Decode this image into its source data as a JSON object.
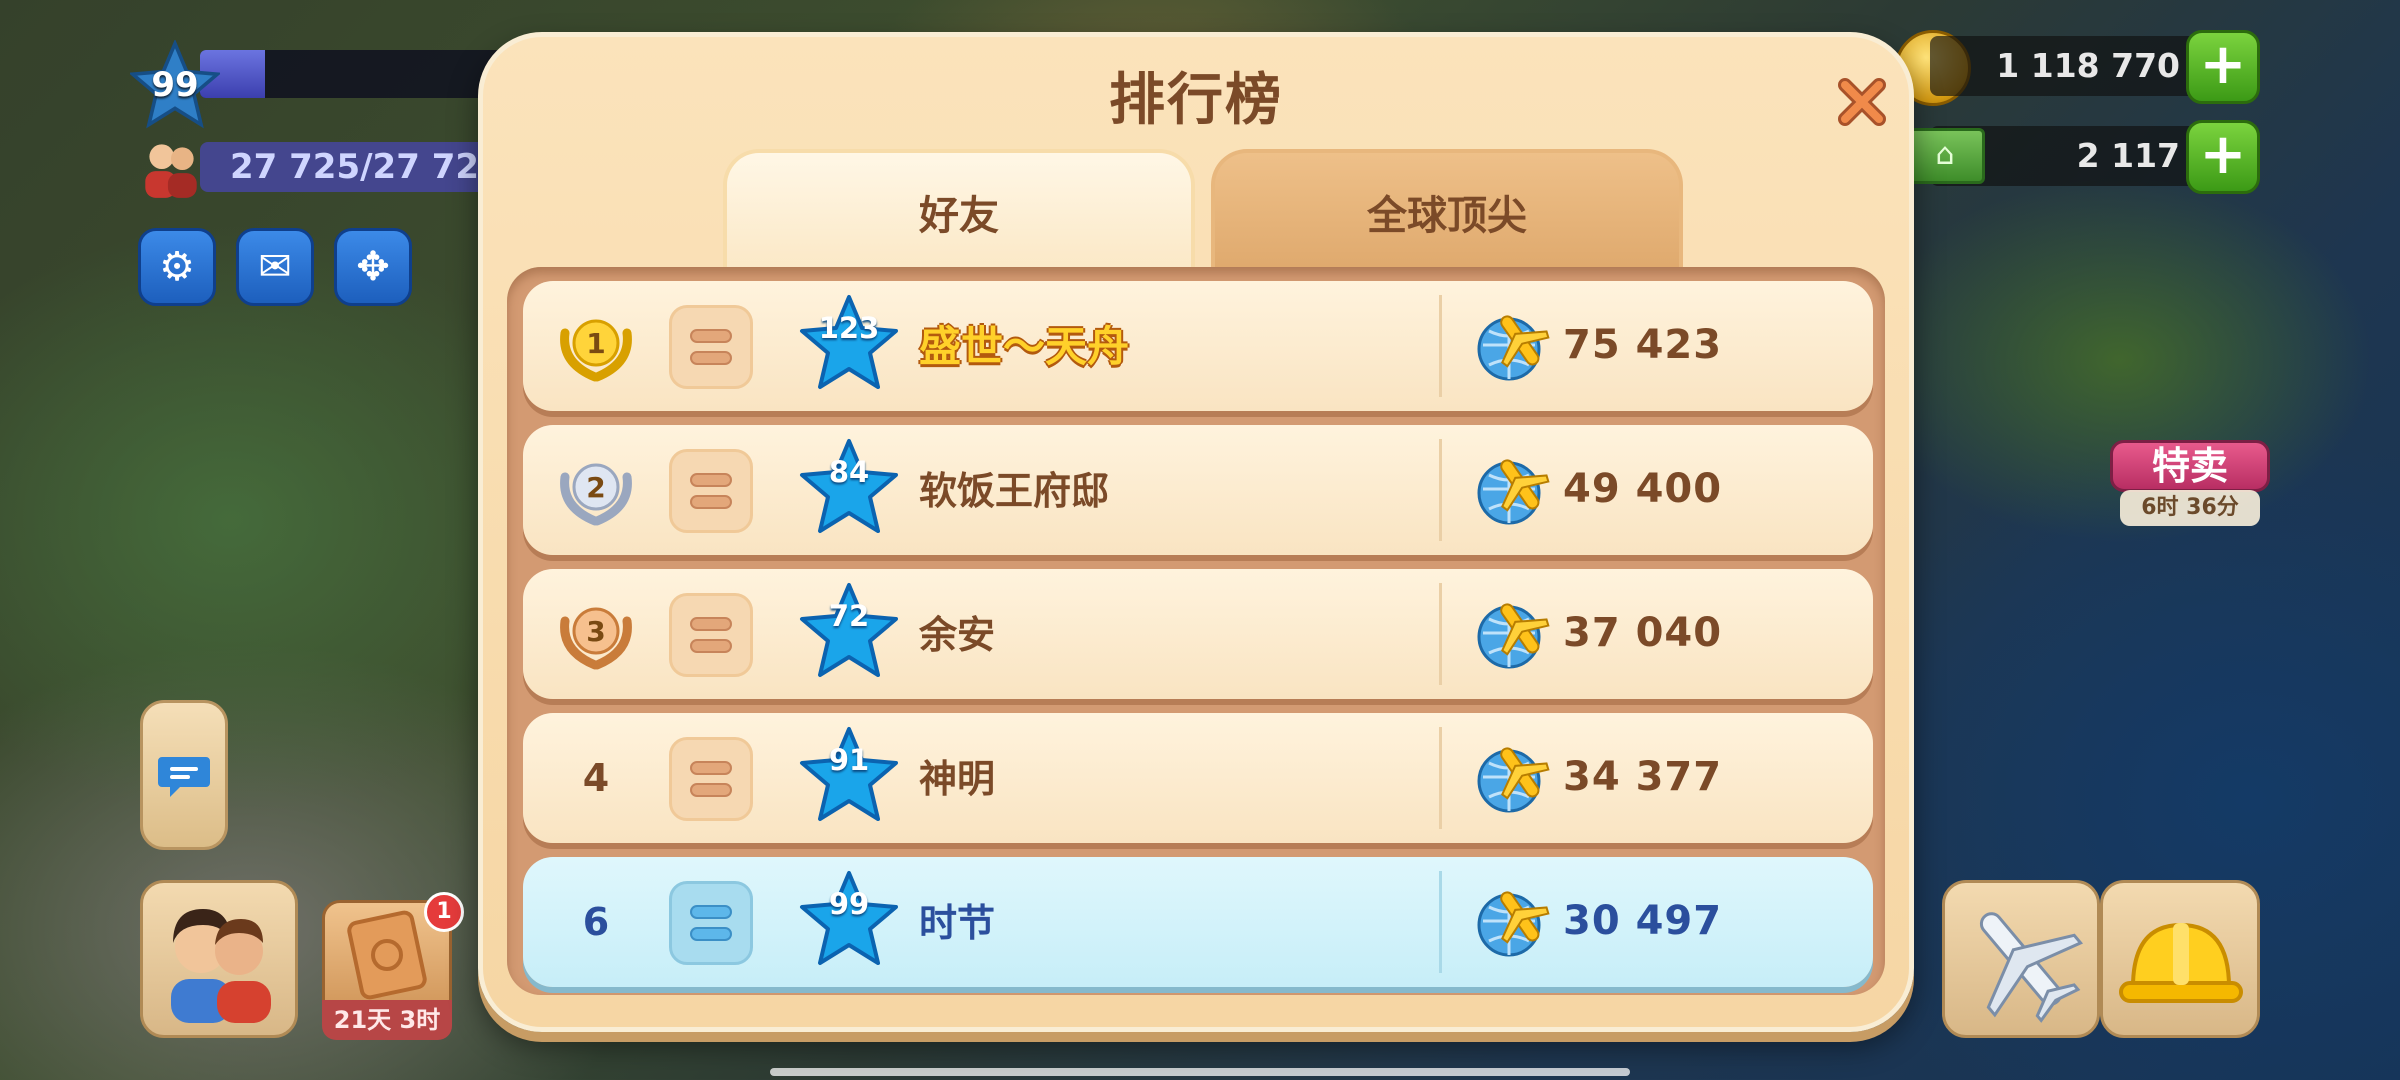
{
  "hud": {
    "level": "99",
    "population": "27 725/27 72",
    "coins": "1 118 770",
    "cash": "2 117",
    "cash_icon": "bank-note-icon",
    "settings_icon": "gear-icon",
    "mail_icon": "mail-icon",
    "move_icon": "move-arrows-icon",
    "ticket_badge": "1",
    "ticket_timer": "21天 3时",
    "special_offer": "特卖",
    "special_timer": "6时 36分"
  },
  "dialog": {
    "title": "排行榜",
    "close_icon": "close-icon",
    "tabs": [
      {
        "label": "好友",
        "active": true
      },
      {
        "label": "全球顶尖",
        "active": false
      }
    ],
    "rows": [
      {
        "rank": "1",
        "medal": "gold",
        "level": "123",
        "name": "盛世～天舟",
        "score": "75 423",
        "highlight_name": true,
        "is_me": false
      },
      {
        "rank": "2",
        "medal": "silver",
        "level": "84",
        "name": "软饭王府邸",
        "score": "49 400",
        "highlight_name": false,
        "is_me": false
      },
      {
        "rank": "3",
        "medal": "bronze",
        "level": "72",
        "name": "余安",
        "score": "37 040",
        "highlight_name": false,
        "is_me": false
      },
      {
        "rank": "4",
        "medal": "",
        "level": "91",
        "name": "神明",
        "score": "34 377",
        "highlight_name": false,
        "is_me": false
      },
      {
        "rank": "6",
        "medal": "",
        "level": "99",
        "name": "时节",
        "score": "30 497",
        "highlight_name": false,
        "is_me": true
      }
    ]
  },
  "colors": {
    "dialog_bg": "#f6d6a4",
    "text_brown": "#7b4a28",
    "me_row": "#c7eef8",
    "me_text": "#2b4f9d",
    "gold_name": "#ffd12a"
  }
}
